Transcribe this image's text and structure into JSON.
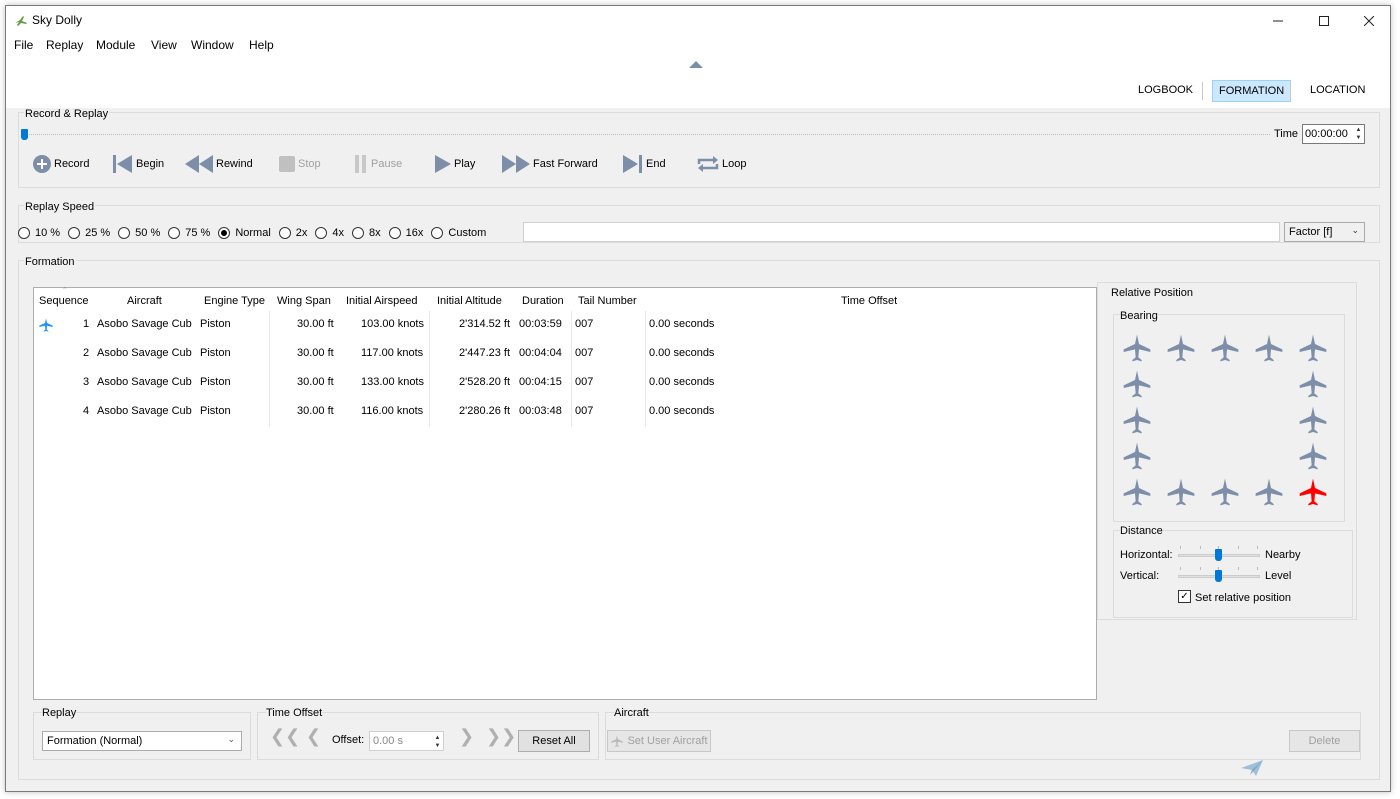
{
  "window": {
    "title": "Sky Dolly"
  },
  "menu": [
    {
      "label": "File"
    },
    {
      "label": "Replay"
    },
    {
      "label": "Module"
    },
    {
      "label": "View"
    },
    {
      "label": "Window"
    },
    {
      "label": "Help"
    }
  ],
  "modules": [
    "LOGBOOK",
    "FORMATION",
    "LOCATION"
  ],
  "active_module": "FORMATION",
  "record_replay": {
    "title": "Record & Replay",
    "time_label": "Time",
    "time_value": "00:00:00",
    "position_fraction": 0.0,
    "buttons": [
      {
        "label": "Record",
        "icon": "record-icon",
        "enabled": true
      },
      {
        "label": "Begin",
        "icon": "skip-begin-icon",
        "enabled": true
      },
      {
        "label": "Rewind",
        "icon": "rewind-icon",
        "enabled": true
      },
      {
        "label": "Stop",
        "icon": "stop-icon",
        "enabled": false
      },
      {
        "label": "Pause",
        "icon": "pause-icon",
        "enabled": false
      },
      {
        "label": "Play",
        "icon": "play-icon",
        "enabled": true
      },
      {
        "label": "Fast Forward",
        "icon": "fast-forward-icon",
        "enabled": true
      },
      {
        "label": "End",
        "icon": "skip-end-icon",
        "enabled": true
      },
      {
        "label": "Loop",
        "icon": "loop-icon",
        "enabled": true
      }
    ]
  },
  "replay_speed": {
    "title": "Replay Speed",
    "options": [
      "10 %",
      "25 %",
      "50 %",
      "75 %",
      "Normal",
      "2x",
      "4x",
      "8x",
      "16x",
      "Custom"
    ],
    "selected": "Normal",
    "custom_value": "",
    "factor_label": "Factor [f]"
  },
  "formation": {
    "title": "Formation",
    "columns": [
      "Sequence",
      "Aircraft",
      "Engine Type",
      "Wing Span",
      "Initial Airspeed",
      "Initial Altitude",
      "Duration",
      "Tail Number",
      "Time Offset"
    ],
    "rows": [
      {
        "sequence": "1",
        "aircraft": "Asobo Savage Cub",
        "engine": "Piston",
        "wing_span": "30.00 ft",
        "airspeed": "103.00 knots",
        "altitude": "2'314.52 ft",
        "duration": "00:03:59",
        "tail": "007",
        "offset": "0.00 seconds",
        "user_aircraft": true
      },
      {
        "sequence": "2",
        "aircraft": "Asobo Savage Cub",
        "engine": "Piston",
        "wing_span": "30.00 ft",
        "airspeed": "117.00 knots",
        "altitude": "2'447.23 ft",
        "duration": "00:04:04",
        "tail": "007",
        "offset": "0.00 seconds",
        "user_aircraft": false
      },
      {
        "sequence": "3",
        "aircraft": "Asobo Savage Cub",
        "engine": "Piston",
        "wing_span": "30.00 ft",
        "airspeed": "133.00 knots",
        "altitude": "2'528.20 ft",
        "duration": "00:04:15",
        "tail": "007",
        "offset": "0.00 seconds",
        "user_aircraft": false
      },
      {
        "sequence": "4",
        "aircraft": "Asobo Savage Cub",
        "engine": "Piston",
        "wing_span": "30.00 ft",
        "airspeed": "116.00 knots",
        "altitude": "2'280.26 ft",
        "duration": "00:03:48",
        "tail": "007",
        "offset": "0.00 seconds",
        "user_aircraft": false
      }
    ]
  },
  "relative_position": {
    "title": "Relative Position",
    "bearing_title": "Bearing",
    "selected_bearing": "south-east",
    "distance_title": "Distance",
    "horizontal_label": "Horizontal:",
    "horizontal_value": "Nearby",
    "horizontal_fraction": 0.5,
    "vertical_label": "Vertical:",
    "vertical_value": "Level",
    "vertical_fraction": 0.5,
    "set_relative_label": "Set relative position",
    "set_relative_checked": true
  },
  "bottom": {
    "replay_title": "Replay",
    "replay_mode": "Formation (Normal)",
    "time_offset_title": "Time Offset",
    "offset_label": "Offset:",
    "offset_value": "0.00 s",
    "reset_all": "Reset All",
    "aircraft_title": "Aircraft",
    "set_user_aircraft": "Set User Aircraft",
    "delete": "Delete"
  },
  "colors": {
    "accent": "#0078d7",
    "plane_inactive": "#7c8ea8",
    "plane_selected": "#ff0000",
    "user_aircraft_icon": "#1e90ff",
    "module_active_bg": "#cce8ff"
  }
}
